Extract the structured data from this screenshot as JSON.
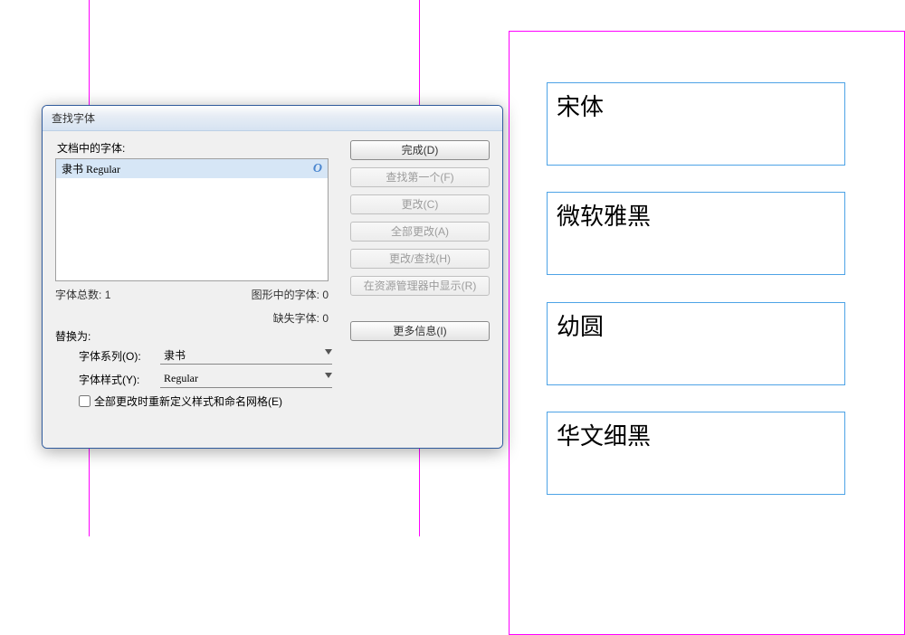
{
  "dialog": {
    "title": "查找字体",
    "fontsInDocLabel": "文档中的字体:",
    "listSelected": "隶书 Regular",
    "totalFontsLabel": "字体总数:",
    "totalFontsValue": "1",
    "inGraphicsLabel": "图形中的字体:",
    "inGraphicsValue": "0",
    "missingLabel": "缺失字体:",
    "missingValue": "0",
    "replaceWithLabel": "替换为:",
    "fontFamilyLabel": "字体系列(O):",
    "fontFamilyValue": "隶书",
    "fontStyleLabel": "字体样式(Y):",
    "fontStyleValue": "Regular",
    "checkboxLabel": "全部更改时重新定义样式和命名网格(E)",
    "buttons": {
      "done": "完成(D)",
      "findFirst": "查找第一个(F)",
      "change": "更改(C)",
      "changeAll": "全部更改(A)",
      "changeFind": "更改/查找(H)",
      "reveal": "在资源管理器中显示(R)",
      "moreInfo": "更多信息(I)"
    }
  },
  "frames": {
    "f1": "宋体",
    "f2": "微软雅黑",
    "f3": "幼圆",
    "f4": "华文细黑"
  }
}
